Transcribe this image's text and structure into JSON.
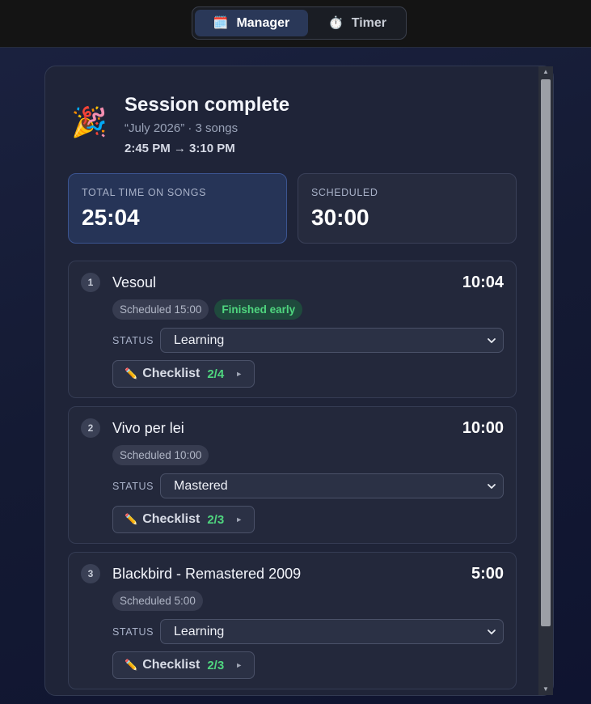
{
  "tabs": [
    {
      "label": "Manager",
      "icon": "calendar-icon",
      "glyph": "🗓️",
      "active": true
    },
    {
      "label": "Timer",
      "icon": "stopwatch-icon",
      "glyph": "⏱️",
      "active": false
    }
  ],
  "session": {
    "icon_glyph": "🎉",
    "title": "Session complete",
    "subtitle": "“July 2026” · 3 songs",
    "time_range": "2:45 PM → 3:10 PM"
  },
  "stats": {
    "total_label": "TOTAL TIME ON SONGS",
    "total_value": "25:04",
    "scheduled_label": "SCHEDULED",
    "scheduled_value": "30:00"
  },
  "status_label": "STATUS",
  "checklist_label": "Checklist",
  "pencil_glyph": "✏️",
  "caret_glyph": "►",
  "songs": [
    {
      "num": "1",
      "name": "Vesoul",
      "time": "10:04",
      "scheduled": "Scheduled 15:00",
      "early": "Finished early",
      "status": "Learning",
      "checklist": "2/4"
    },
    {
      "num": "2",
      "name": "Vivo per lei",
      "time": "10:00",
      "scheduled": "Scheduled 10:00",
      "early": "",
      "status": "Mastered",
      "checklist": "2/3"
    },
    {
      "num": "3",
      "name": "Blackbird - Remastered 2009",
      "time": "5:00",
      "scheduled": "Scheduled 5:00",
      "early": "",
      "status": "Learning",
      "checklist": "2/3"
    }
  ],
  "colors": {
    "accent_green": "#4fd67f",
    "active_tab": "#2a3858",
    "total_card": "#263457"
  }
}
